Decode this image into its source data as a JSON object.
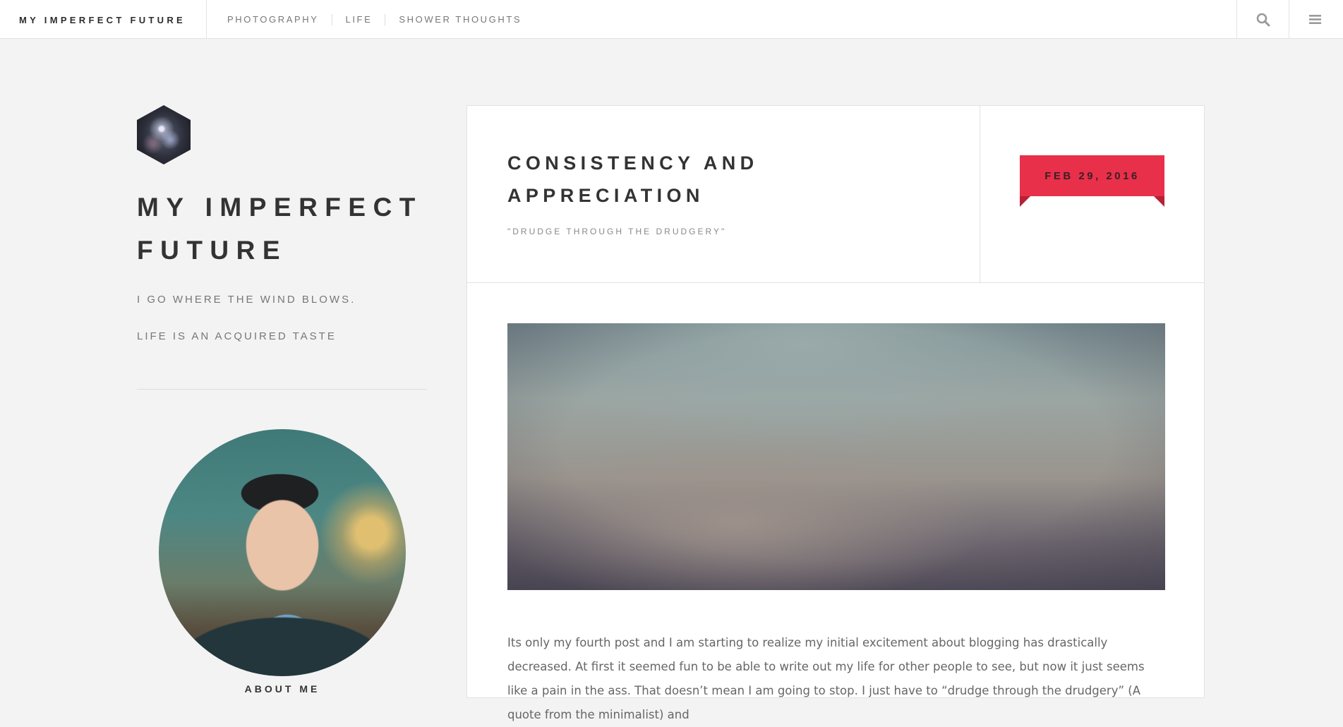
{
  "header": {
    "brand": "MY IMPERFECT FUTURE",
    "nav": [
      "PHOTOGRAPHY",
      "LIFE",
      "SHOWER THOUGHTS"
    ],
    "icons": [
      "search-icon",
      "hamburger-menu-icon"
    ]
  },
  "sidebar": {
    "title": "MY IMPERFECT FUTURE",
    "taglines": [
      "I GO WHERE THE WIND BLOWS.",
      "LIFE IS AN ACQUIRED TASTE"
    ],
    "about_label": "ABOUT ME"
  },
  "post": {
    "title": "CONSISTENCY AND APPRECIATION",
    "subtitle": "\"DRUDGE THROUGH THE DRUDGERY\"",
    "date": "FEB 29, 2016",
    "body": "Its only my fourth post and I am starting to realize my initial excitement about blogging has drastically decreased. At first it seemed fun to be able to write out my life for other people to see, but now it just seems like a pain in the ass. That doesn’t mean I am going to stop. I just have to “drudge through the drudgery” (A quote from the minimalist) and"
  },
  "colors": {
    "background": "#f3f3f3",
    "accent_ribbon": "#e8304a",
    "text_dark": "#333333",
    "text_muted": "#777777"
  }
}
